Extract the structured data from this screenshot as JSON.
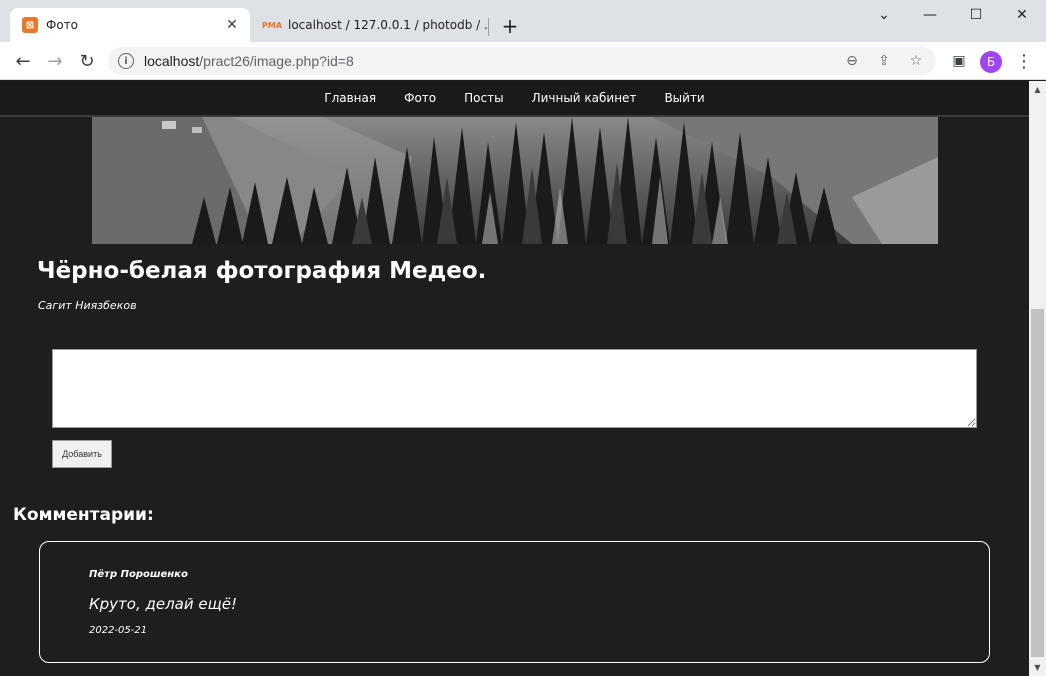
{
  "browser": {
    "tabs": [
      {
        "title": "Фото",
        "favicon": "xampp-icon",
        "active": true
      },
      {
        "title": "localhost / 127.0.0.1 / photodb / ...",
        "favicon": "phpmyadmin-icon",
        "active": false
      }
    ],
    "url_host": "localhost",
    "url_path": "/pract26/image.php?id=8",
    "profile_initial": "Б",
    "profile_color": "#a142f4"
  },
  "nav": {
    "items": [
      "Главная",
      "Фото",
      "Посты",
      "Личный кабинет",
      "Выйти"
    ]
  },
  "photo": {
    "title": "Чёрно-белая фотография Медео.",
    "author": "Сагит Ниязбеков"
  },
  "comment_form": {
    "textarea_value": "",
    "submit_label": "Добавить"
  },
  "comments": {
    "heading": "Комментарии:",
    "items": [
      {
        "author": "Пётр Порошенко",
        "text": "Круто, делай ещё!",
        "date": "2022-05-21"
      }
    ]
  }
}
